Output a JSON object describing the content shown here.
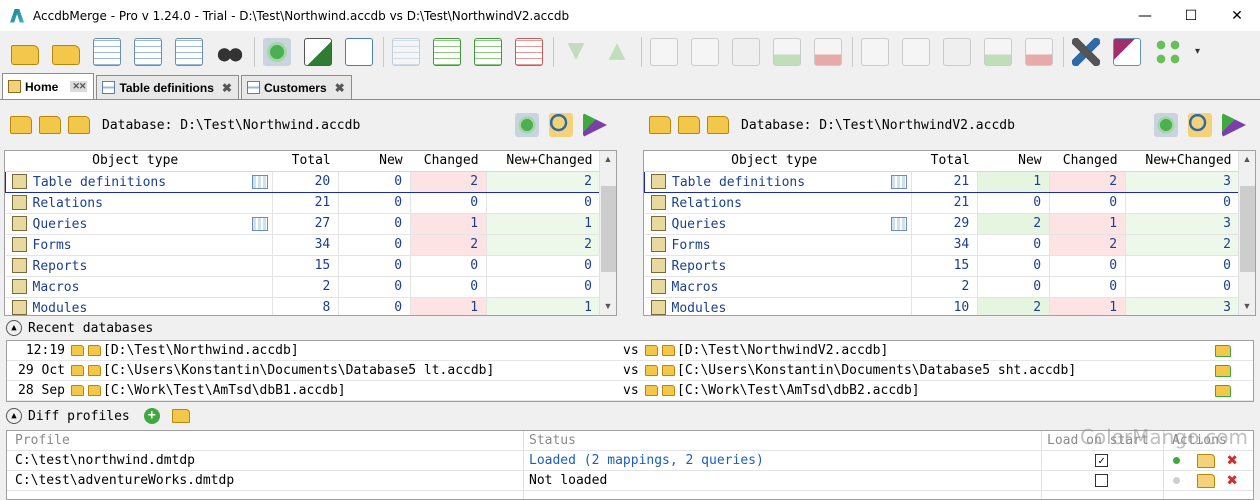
{
  "window": {
    "title": "AccdbMerge - Pro v 1.24.0 - Trial - D:\\Test\\Northwind.accdb vs D:\\Test\\NorthwindV2.accdb",
    "minimize": "—",
    "maximize": "☐",
    "close": "✕"
  },
  "toolbar": {
    "icons": [
      "open-left-icon",
      "open-both-icon",
      "compare-tables-icon",
      "sql-icon",
      "settings-grid-icon",
      "binoculars-icon",
      "refresh-icon",
      "export-excel-icon",
      "copy-icon",
      "grid-icon",
      "grid-green-icon",
      "grid-green2-icon",
      "grid-red-icon",
      "arrow-down-icon",
      "arrow-up-icon",
      "check-doc-icon",
      "blank-doc-icon",
      "check-doc2-icon",
      "move-right-icon",
      "delete-right-icon",
      "check-doc3-icon",
      "blank-doc2-icon",
      "check-doc4-icon",
      "move-left-icon",
      "delete-left-icon",
      "tools-icon",
      "access-grid-icon",
      "arrows-icon"
    ],
    "more": "▾"
  },
  "tabs": [
    {
      "label": "Home",
      "active": true
    },
    {
      "label": "Table definitions",
      "active": false
    },
    {
      "label": "Customers",
      "active": false
    }
  ],
  "tab_close": "✖",
  "tab_pin": "✕✕",
  "left": {
    "database_label": "Database: D:\\Test\\Northwind.accdb",
    "headers": [
      "Object type",
      "Total",
      "New",
      "Changed",
      "New+Changed"
    ],
    "rows": [
      {
        "name": "Table definitions",
        "total": "20",
        "new": "0",
        "changed": "2",
        "newchanged": "2"
      },
      {
        "name": "Relations",
        "total": "21",
        "new": "0",
        "changed": "0",
        "newchanged": "0"
      },
      {
        "name": "Queries",
        "total": "27",
        "new": "0",
        "changed": "1",
        "newchanged": "1"
      },
      {
        "name": "Forms",
        "total": "34",
        "new": "0",
        "changed": "2",
        "newchanged": "2"
      },
      {
        "name": "Reports",
        "total": "15",
        "new": "0",
        "changed": "0",
        "newchanged": "0"
      },
      {
        "name": "Macros",
        "total": "2",
        "new": "0",
        "changed": "0",
        "newchanged": "0"
      },
      {
        "name": "Modules",
        "total": "8",
        "new": "0",
        "changed": "1",
        "newchanged": "1"
      }
    ]
  },
  "right": {
    "database_label": "Database: D:\\Test\\NorthwindV2.accdb",
    "headers": [
      "Object type",
      "Total",
      "New",
      "Changed",
      "New+Changed"
    ],
    "rows": [
      {
        "name": "Table definitions",
        "total": "21",
        "new": "1",
        "changed": "2",
        "newchanged": "3"
      },
      {
        "name": "Relations",
        "total": "21",
        "new": "0",
        "changed": "0",
        "newchanged": "0"
      },
      {
        "name": "Queries",
        "total": "29",
        "new": "2",
        "changed": "1",
        "newchanged": "3"
      },
      {
        "name": "Forms",
        "total": "34",
        "new": "0",
        "changed": "2",
        "newchanged": "2"
      },
      {
        "name": "Reports",
        "total": "15",
        "new": "0",
        "changed": "0",
        "newchanged": "0"
      },
      {
        "name": "Macros",
        "total": "2",
        "new": "0",
        "changed": "0",
        "newchanged": "0"
      },
      {
        "name": "Modules",
        "total": "10",
        "new": "2",
        "changed": "1",
        "newchanged": "3"
      }
    ]
  },
  "recent": {
    "title": "Recent databases",
    "vs": "vs",
    "rows": [
      {
        "date": "12:19",
        "left": "[D:\\Test\\Northwind.accdb]",
        "right": "[D:\\Test\\NorthwindV2.accdb]"
      },
      {
        "date": "29 Oct",
        "left": "[C:\\Users\\Konstantin\\Documents\\Database5 lt.accdb]",
        "right": "[C:\\Users\\Konstantin\\Documents\\Database5 sht.accdb]"
      },
      {
        "date": "28 Sep",
        "left": "[C:\\Work\\Test\\AmTsd\\dbB1.accdb]",
        "right": "[C:\\Work\\Test\\AmTsd\\dbB2.accdb]"
      }
    ]
  },
  "profiles": {
    "title": "Diff profiles",
    "add": "+",
    "headers": {
      "profile": "Profile",
      "status": "Status",
      "load": "Load on start",
      "actions": "Actions"
    },
    "rows": [
      {
        "profile": "C:\\test\\northwind.dmtdp",
        "status": "Loaded (2 mappings, 2 queries)",
        "load": "✓",
        "loaded": true
      },
      {
        "profile": "C:\\test\\adventureWorks.dmtdp",
        "status": "Not loaded",
        "load": "",
        "loaded": false
      }
    ],
    "delete": "✖"
  },
  "watermark": "ColorMango.com",
  "colors": {
    "link": "#1b5fb5",
    "selection": "#1c2ba8",
    "changed": "#fde3e3",
    "new": "#e6f5e0"
  }
}
